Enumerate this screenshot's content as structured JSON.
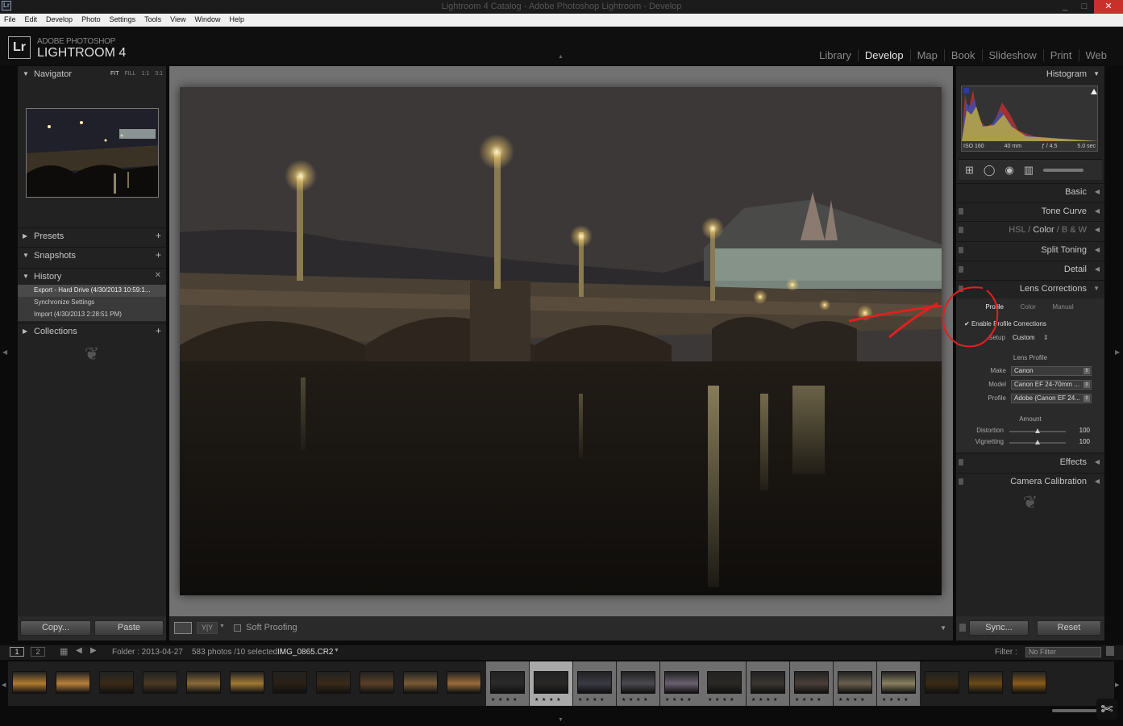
{
  "window": {
    "title": "Lightroom 4 Catalog - Adobe Photoshop Lightroom - Develop",
    "app_icon": "Lr",
    "controls": [
      "_",
      "□",
      "✕"
    ]
  },
  "menu": [
    "File",
    "Edit",
    "Develop",
    "Photo",
    "Settings",
    "Tools",
    "View",
    "Window",
    "Help"
  ],
  "brand": {
    "logo": "Lr",
    "sub": "ADOBE PHOTOSHOP",
    "name": "LIGHTROOM 4"
  },
  "modules": [
    "Library",
    "Develop",
    "Map",
    "Book",
    "Slideshow",
    "Print",
    "Web"
  ],
  "active_module": "Develop",
  "left": {
    "navigator": {
      "title": "Navigator",
      "zoom": [
        "FIT",
        "FILL",
        "1:1",
        "3:1"
      ]
    },
    "presets": "Presets",
    "snapshots": "Snapshots",
    "history": {
      "title": "History",
      "items": [
        "Export - Hard Drive (4/30/2013 10:59:1...",
        "Synchronize Settings",
        "Import (4/30/2013 2:28:51 PM)"
      ]
    },
    "collections": "Collections",
    "copy": "Copy...",
    "paste": "Paste"
  },
  "right": {
    "histogram": {
      "title": "Histogram",
      "iso": "ISO 160",
      "focal": "40 mm",
      "aperture": "ƒ / 4.5",
      "shutter": "5.0 sec"
    },
    "panels": {
      "basic": "Basic",
      "tone_curve": "Tone Curve",
      "hsl": "HSL",
      "color": "Color",
      "bw": "B & W",
      "split": "Split Toning",
      "detail": "Detail",
      "lens": "Lens Corrections",
      "effects": "Effects",
      "calibration": "Camera Calibration"
    },
    "lens": {
      "tabs": [
        "Profile",
        "Color",
        "Manual"
      ],
      "enable": "Enable Profile Corrections",
      "setup_label": "Setup",
      "setup_value": "Custom",
      "section": "Lens Profile",
      "make_label": "Make",
      "make_value": "Canon",
      "model_label": "Model",
      "model_value": "Canon EF 24-70mm ...",
      "profile_label": "Profile",
      "profile_value": "Adobe (Canon EF 24...",
      "amount": "Amount",
      "distortion_label": "Distortion",
      "distortion_value": "100",
      "vignetting_label": "Vignetting",
      "vignetting_value": "100"
    },
    "sync": "Sync...",
    "reset": "Reset"
  },
  "toolbar": {
    "soft_proofing": "Soft Proofing"
  },
  "filmbar": {
    "screen1": "1",
    "screen2": "2",
    "folder": "Folder : 2013-04-27",
    "count": "583 photos /10 selected /",
    "filename": "IMG_0865.CR2",
    "filter_label": "Filter :",
    "filter_value": "No Filter"
  },
  "filmstrip": {
    "thumbs": [
      {
        "tone": "#b07a30",
        "sel": false
      },
      {
        "tone": "#b8803a",
        "sel": false
      },
      {
        "tone": "#3a2a18",
        "sel": false
      },
      {
        "tone": "#4a3a24",
        "sel": false
      },
      {
        "tone": "#8a6a3a",
        "sel": false
      },
      {
        "tone": "#a07834",
        "sel": false
      },
      {
        "tone": "#2a2016",
        "sel": false
      },
      {
        "tone": "#3a2a1a",
        "sel": false
      },
      {
        "tone": "#5a4028",
        "sel": false
      },
      {
        "tone": "#7a5a34",
        "sel": false
      },
      {
        "tone": "#9a6a3a",
        "sel": false
      },
      {
        "tone": "#2a2a2a",
        "sel": true,
        "primary": false
      },
      {
        "tone": "#2a2626",
        "sel": true,
        "primary": true
      },
      {
        "tone": "#3a3a44",
        "sel": true,
        "primary": false
      },
      {
        "tone": "#4a4a50",
        "sel": true,
        "primary": false
      },
      {
        "tone": "#6a6070",
        "sel": true,
        "primary": false
      },
      {
        "tone": "#2a2824",
        "sel": true,
        "primary": false
      },
      {
        "tone": "#3a3630",
        "sel": true,
        "primary": false
      },
      {
        "tone": "#4a4038",
        "sel": true,
        "primary": false
      },
      {
        "tone": "#6a6050",
        "sel": true,
        "primary": false
      },
      {
        "tone": "#8a8060",
        "sel": true,
        "primary": false
      },
      {
        "tone": "#3a2a14",
        "sel": false
      },
      {
        "tone": "#6a4a1a",
        "sel": false
      },
      {
        "tone": "#8a5a1a",
        "sel": false
      }
    ],
    "stars": "★ ★ ★ ★"
  },
  "colors": {
    "accent": "#c9302c",
    "panel": "#222222",
    "center": "#727272"
  }
}
